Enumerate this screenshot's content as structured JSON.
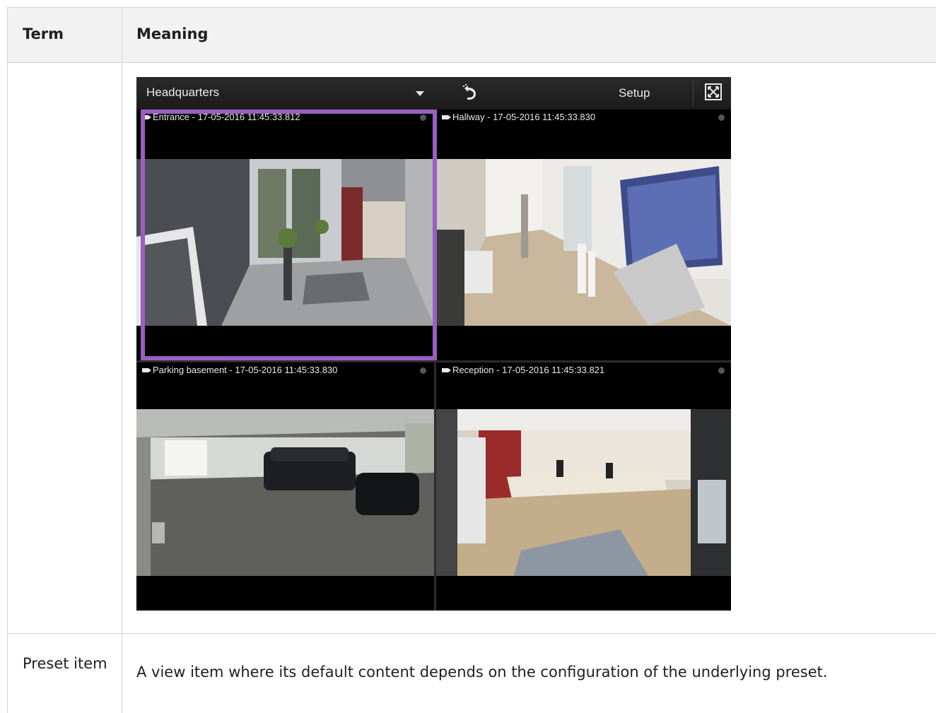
{
  "table": {
    "headers": {
      "term": "Term",
      "meaning": "Meaning"
    },
    "rows": [
      {
        "term": "",
        "meaning": ""
      },
      {
        "term": "Preset item",
        "meaning": "A view item where its default content depends on the configuration of the underlying preset."
      }
    ]
  },
  "client": {
    "view_name": "Headquarters",
    "setup_label": "Setup",
    "icons": [
      "dropdown-caret-icon",
      "undo-icon",
      "camera-icon",
      "fullscreen-icon"
    ],
    "selection_color": "#9a5fc0",
    "tiles": [
      {
        "caption": "Entrance - 17-05-2016 11:45:33.812",
        "selected": true
      },
      {
        "caption": "Hallway - 17-05-2016 11:45:33.830",
        "selected": false
      },
      {
        "caption": "Parking basement - 17-05-2016 11:45:33.830",
        "selected": false
      },
      {
        "caption": "Reception - 17-05-2016 11:45:33.821",
        "selected": false
      }
    ]
  }
}
